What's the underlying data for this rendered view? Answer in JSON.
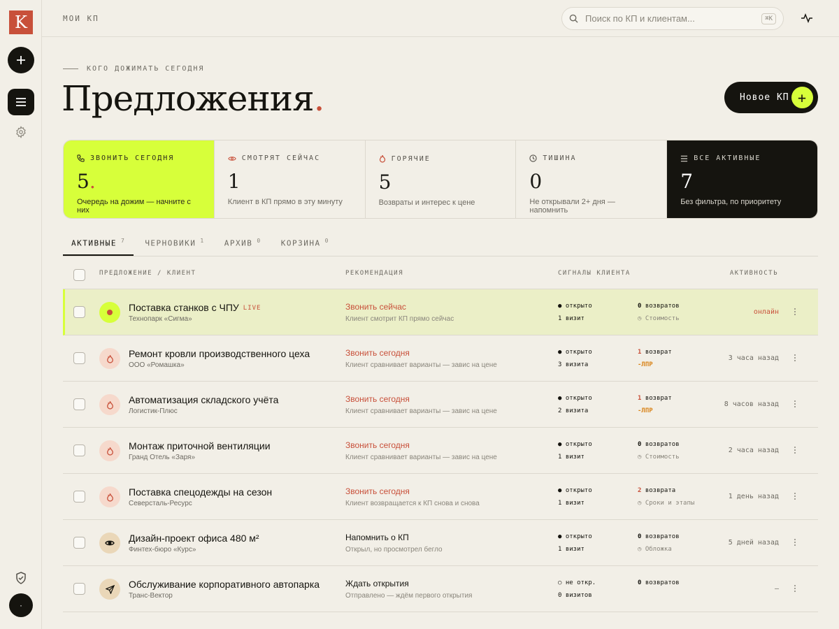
{
  "sidebar": {
    "logo": "K",
    "add_icon": "plus-icon",
    "menu_icon": "menu-icon",
    "settings_icon": "gear-icon",
    "shield_icon": "shield-check-icon",
    "avatar_text": "·"
  },
  "topbar": {
    "crumb": "МОИ КП",
    "search_placeholder": "Поиск по КП и клиентам...",
    "shortcut": "⌘K"
  },
  "header": {
    "eyebrow": "КОГО ДОЖИМАТЬ СЕГОДНЯ",
    "title": "Предложения",
    "title_dot": ".",
    "new_button": "Новое КП",
    "new_button_icon": "+"
  },
  "stats": [
    {
      "label": "ЗВОНИТЬ СЕГОДНЯ",
      "value": "5",
      "dot": ".",
      "sub": "Очередь на дожим — начните с них",
      "icon": "phone-icon"
    },
    {
      "label": "СМОТРЯТ СЕЙЧАС",
      "value": "1",
      "sub": "Клиент в КП прямо в эту минуту",
      "icon": "eye-icon"
    },
    {
      "label": "ГОРЯЧИЕ",
      "value": "5",
      "sub": "Возвраты и интерес к цене",
      "icon": "fire-icon"
    },
    {
      "label": "ТИШИНА",
      "value": "0",
      "sub": "Не открывали 2+ дня — напомнить",
      "icon": "clock-icon"
    },
    {
      "label": "ВСЕ АКТИВНЫЕ",
      "value": "7",
      "sub": "Без фильтра, по приоритету",
      "icon": "list-icon"
    }
  ],
  "tabs": [
    {
      "label": "АКТИВНЫЕ",
      "count": "7"
    },
    {
      "label": "ЧЕРНОВИКИ",
      "count": "1"
    },
    {
      "label": "АРХИВ",
      "count": "0"
    },
    {
      "label": "КОРЗИНА",
      "count": "0"
    }
  ],
  "table": {
    "columns": [
      "ПРЕДЛОЖЕНИЕ / КЛИЕНТ",
      "РЕКОМЕНДАЦИЯ",
      "СИГНАЛЫ КЛИЕНТА",
      "АКТИВНОСТЬ"
    ],
    "rows": [
      {
        "name": "Поставка станков с ЧПУ",
        "badge": "LIVE",
        "client": "Технопарк «Сигма»",
        "rec": "Звонить сейчас",
        "rec_sub": "Клиент смотрит КП прямо сейчас",
        "s1": "● открыто",
        "s2": "1 визит",
        "s3_num": "0",
        "s3_text": " возвратов",
        "s4": "◷ Стоимость",
        "activity": "онлайн",
        "icon": "live-dot-icon"
      },
      {
        "name": "Ремонт кровли производственного цеха",
        "badge": "",
        "client": "ООО «Ромашка»",
        "rec": "Звонить сегодня",
        "rec_sub": "Клиент сравнивает варианты — завис на цене",
        "s1": "● открыто",
        "s2": "3 визита",
        "s3_num": "1",
        "s3_text": " возврат",
        "s4": "-ЛПР",
        "activity": "3 часа назад",
        "icon": "fire-icon"
      },
      {
        "name": "Автоматизация складского учёта",
        "badge": "",
        "client": "Логистик-Плюс",
        "rec": "Звонить сегодня",
        "rec_sub": "Клиент сравнивает варианты — завис на цене",
        "s1": "● открыто",
        "s2": "2 визита",
        "s3_num": "1",
        "s3_text": " возврат",
        "s4": "-ЛПР",
        "activity": "8 часов назад",
        "icon": "fire-icon"
      },
      {
        "name": "Монтаж приточной вентиляции",
        "badge": "",
        "client": "Гранд Отель «Заря»",
        "rec": "Звонить сегодня",
        "rec_sub": "Клиент сравнивает варианты — завис на цене",
        "s1": "● открыто",
        "s2": "1 визит",
        "s3_num": "0",
        "s3_text": " возвратов",
        "s4": "◷ Стоимость",
        "activity": "2 часа назад",
        "icon": "fire-icon"
      },
      {
        "name": "Поставка спецодежды на сезон",
        "badge": "",
        "client": "Северсталь-Ресурс",
        "rec": "Звонить сегодня",
        "rec_sub": "Клиент возвращается к КП снова и снова",
        "s1": "● открыто",
        "s2": "1 визит",
        "s3_num": "2",
        "s3_text": " возврата",
        "s4": "◷ Сроки и этапы",
        "activity": "1 день назад",
        "icon": "fire-icon"
      },
      {
        "name": "Дизайн-проект офиса 480 м²",
        "badge": "",
        "client": "Финтех-бюро «Курс»",
        "rec": "Напомнить о КП",
        "rec_sub": "Открыл, но просмотрел бегло",
        "s1": "● открыто",
        "s2": "1 визит",
        "s3_num": "0",
        "s3_text": " возвратов",
        "s4": "◷ Обложка",
        "activity": "5 дней назад",
        "icon": "eye-icon"
      },
      {
        "name": "Обслуживание корпоративного автопарка",
        "badge": "",
        "client": "Транс-Вектор",
        "rec": "Ждать открытия",
        "rec_sub": "Отправлено — ждём первого открытия",
        "s1": "○ не откр.",
        "s2": "0 визитов",
        "s3_num": "0",
        "s3_text": " возвратов",
        "s4": "",
        "activity": "—",
        "icon": "send-icon"
      }
    ]
  },
  "colors": {
    "accent_lime": "#d7ff3a",
    "accent_red": "#c8503a",
    "dark": "#15140f",
    "background": "#f2efe7",
    "warning": "#d9841a"
  }
}
